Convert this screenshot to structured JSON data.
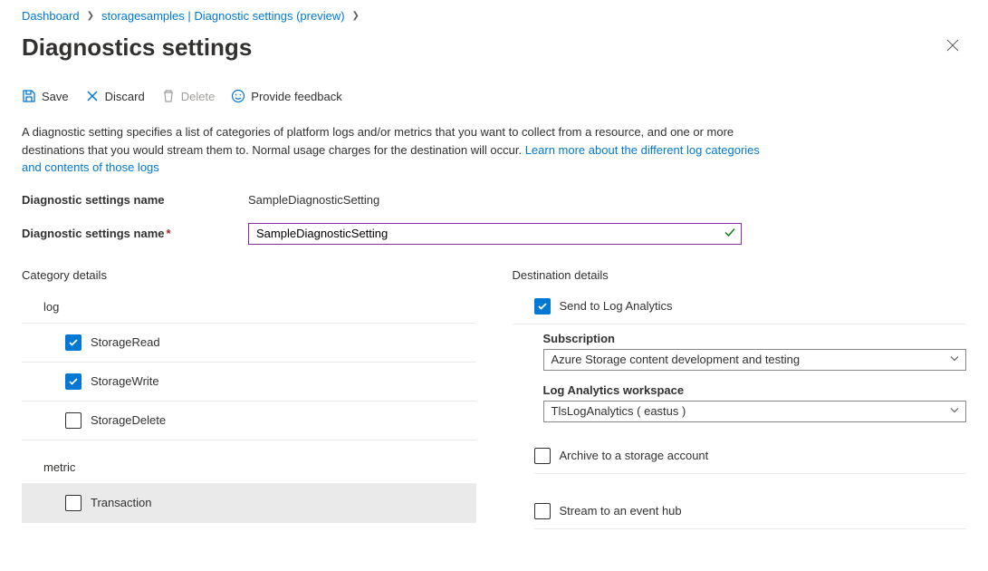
{
  "breadcrumb": {
    "items": [
      "Dashboard",
      "storagesamples | Diagnostic settings (preview)"
    ]
  },
  "header": {
    "title": "Diagnostics settings"
  },
  "toolbar": {
    "save": "Save",
    "discard": "Discard",
    "delete": "Delete",
    "feedback": "Provide feedback"
  },
  "description": {
    "text_a": "A diagnostic setting specifies a list of categories of platform logs and/or metrics that you want to collect from a resource, and one or more destinations that you would stream them to. Normal usage charges for the destination will occur. ",
    "link": "Learn more about the different log categories and contents of those logs"
  },
  "form": {
    "name_label": "Diagnostic settings name",
    "name_value": "SampleDiagnosticSetting",
    "name_input_label": "Diagnostic settings name",
    "name_input_value": "SampleDiagnosticSetting"
  },
  "category": {
    "title": "Category details",
    "log_header": "log",
    "logs": [
      {
        "label": "StorageRead",
        "checked": true
      },
      {
        "label": "StorageWrite",
        "checked": true
      },
      {
        "label": "StorageDelete",
        "checked": false
      }
    ],
    "metric_header": "metric",
    "metrics": [
      {
        "label": "Transaction",
        "checked": false,
        "selected": true
      }
    ]
  },
  "destination": {
    "title": "Destination details",
    "send_log_analytics": {
      "label": "Send to Log Analytics",
      "checked": true
    },
    "subscription_label": "Subscription",
    "subscription_value": "Azure Storage content development and testing",
    "workspace_label": "Log Analytics workspace",
    "workspace_value": "TlsLogAnalytics ( eastus )",
    "archive": {
      "label": "Archive to a storage account",
      "checked": false
    },
    "stream": {
      "label": "Stream to an event hub",
      "checked": false
    }
  }
}
